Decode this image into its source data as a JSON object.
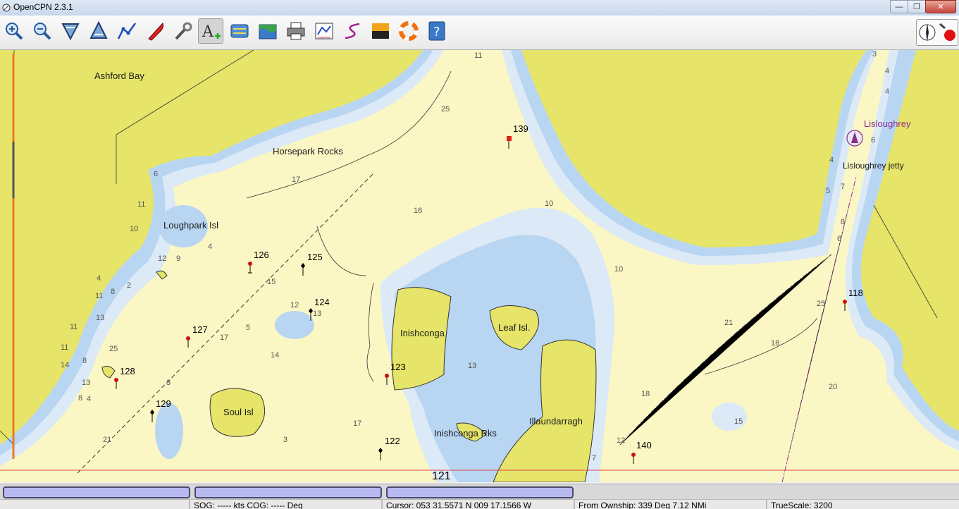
{
  "window": {
    "title": "OpenCPN 2.3.1",
    "minimize": "—",
    "maximize": "❐",
    "close": "✕"
  },
  "toolbar": {
    "buttons": [
      {
        "name": "zoom-in-button",
        "icon": "zoom-in-icon"
      },
      {
        "name": "zoom-out-button",
        "icon": "zoom-out-icon"
      },
      {
        "name": "scale-in-button",
        "icon": "chart-scale-in-icon"
      },
      {
        "name": "scale-out-button",
        "icon": "chart-scale-out-icon"
      },
      {
        "name": "create-route-button",
        "icon": "route-icon"
      },
      {
        "name": "auto-follow-button",
        "icon": "ship-icon"
      },
      {
        "name": "toolbox-button",
        "icon": "wrench-icon"
      },
      {
        "name": "text-button",
        "icon": "text-add-icon",
        "active": true
      },
      {
        "name": "current-button",
        "icon": "current-icon"
      },
      {
        "name": "tide-button",
        "icon": "tide-icon"
      },
      {
        "name": "print-button",
        "icon": "printer-icon"
      },
      {
        "name": "route-manager-button",
        "icon": "route-manager-icon"
      },
      {
        "name": "track-button",
        "icon": "track-icon"
      },
      {
        "name": "color-scheme-button",
        "icon": "color-scheme-icon"
      },
      {
        "name": "mob-button",
        "icon": "lifebuoy-icon"
      },
      {
        "name": "help-button",
        "icon": "help-icon"
      }
    ],
    "compass_icon": "compass-rose-icon",
    "gps_status_icon": "gps-status-icon"
  },
  "chart": {
    "place_names": [
      "Ashford Bay",
      "Horsepark Rocks",
      "Loughpark Isl",
      "Inishconga",
      "Leaf Isl.",
      "Soul Isl",
      "Inishconga Rks",
      "Illaundarragh",
      "Lisloughrey",
      "Lisloughrey jetty"
    ],
    "waypoints": [
      "139",
      "126",
      "125",
      "124",
      "127",
      "128",
      "129",
      "123",
      "122",
      "140",
      "118"
    ],
    "range_label": "121",
    "soundings": [
      "11",
      "25",
      "6",
      "17",
      "16",
      "10",
      "11",
      "10",
      "4",
      "12",
      "9",
      "4",
      "8",
      "2",
      "11",
      "13",
      "11",
      "11",
      "25",
      "14",
      "8",
      "13",
      "8",
      "4",
      "3",
      "15",
      "12",
      "13",
      "17",
      "5",
      "14",
      "21",
      "3",
      "17",
      "13",
      "10",
      "21",
      "18",
      "18",
      "12",
      "7",
      "4",
      "4",
      "6",
      "4",
      "5",
      "7",
      "8",
      "6",
      "25",
      "20",
      "15",
      "3"
    ]
  },
  "piano_keys": [
    "chart-1",
    "chart-2",
    "chart-3"
  ],
  "status": {
    "sog": "SOG: ----- kts  COG: ----- Deg",
    "cursor": "Cursor: 053 31.5571 N 009 17.1566 W",
    "from_ownship": "From Ownship: 339 Deg     7.12 NMi",
    "truescale": "TrueScale:      3200"
  }
}
